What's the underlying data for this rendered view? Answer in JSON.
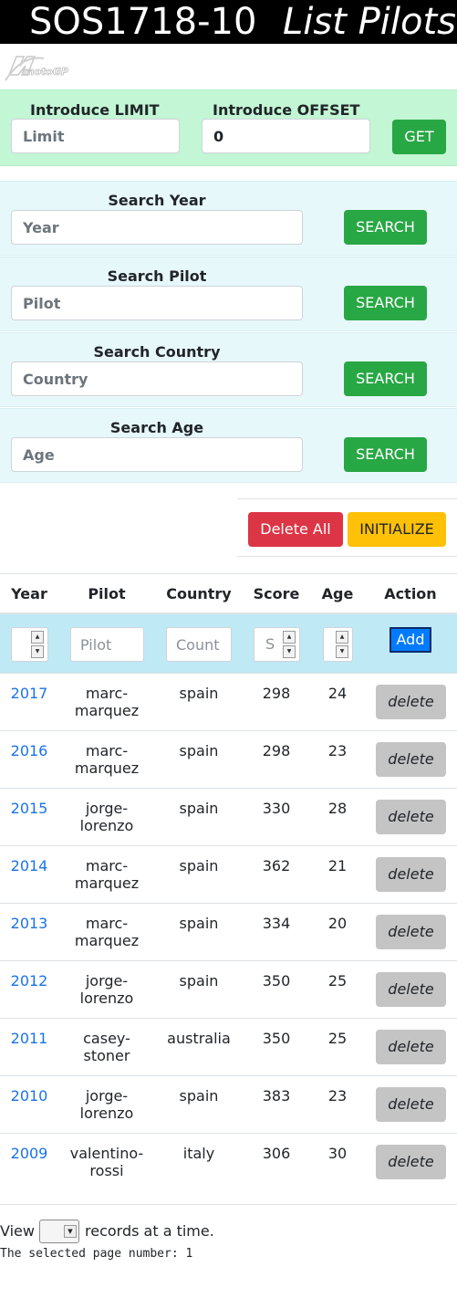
{
  "header": {
    "code": "SOS1718-10",
    "subtitle": "List Pilots"
  },
  "logo": {
    "text": "motoGP"
  },
  "limit_panel": {
    "limit_label": "Introduce LIMIT",
    "limit_placeholder": "Limit",
    "offset_label": "Introduce OFFSET",
    "offset_value": "0",
    "get_button": "GET"
  },
  "search": [
    {
      "label": "Search Year",
      "placeholder": "Year",
      "button": "SEARCH"
    },
    {
      "label": "Search Pilot",
      "placeholder": "Pilot",
      "button": "SEARCH"
    },
    {
      "label": "Search Country",
      "placeholder": "Country",
      "button": "SEARCH"
    },
    {
      "label": "Search Age",
      "placeholder": "Age",
      "button": "SEARCH"
    }
  ],
  "actions": {
    "delete_all": "Delete All",
    "initialize": "INITIALIZE"
  },
  "table": {
    "headers": [
      "Year",
      "Pilot",
      "Country",
      "Score",
      "Age",
      "Action"
    ],
    "new_row": {
      "pilot_placeholder": "Pilot",
      "country_placeholder": "Count",
      "score_placeholder": "S",
      "add_button": "Add"
    },
    "rows": [
      {
        "year": "2017",
        "pilot": "marc-marquez",
        "country": "spain",
        "score": "298",
        "age": "24",
        "action": "delete"
      },
      {
        "year": "2016",
        "pilot": "marc-marquez",
        "country": "spain",
        "score": "298",
        "age": "23",
        "action": "delete"
      },
      {
        "year": "2015",
        "pilot": "jorge-lorenzo",
        "country": "spain",
        "score": "330",
        "age": "28",
        "action": "delete"
      },
      {
        "year": "2014",
        "pilot": "marc-marquez",
        "country": "spain",
        "score": "362",
        "age": "21",
        "action": "delete"
      },
      {
        "year": "2013",
        "pilot": "marc-marquez",
        "country": "spain",
        "score": "334",
        "age": "20",
        "action": "delete"
      },
      {
        "year": "2012",
        "pilot": "jorge-lorenzo",
        "country": "spain",
        "score": "350",
        "age": "25",
        "action": "delete"
      },
      {
        "year": "2011",
        "pilot": "casey-stoner",
        "country": "australia",
        "score": "350",
        "age": "25",
        "action": "delete"
      },
      {
        "year": "2010",
        "pilot": "jorge-lorenzo",
        "country": "spain",
        "score": "383",
        "age": "23",
        "action": "delete"
      },
      {
        "year": "2009",
        "pilot": "valentino-rossi",
        "country": "italy",
        "score": "306",
        "age": "30",
        "action": "delete"
      }
    ]
  },
  "pager": {
    "view_prefix": "View",
    "view_suffix": "records at a time.",
    "selected_page_text": "The selected page number: 1"
  },
  "colors": {
    "limit_panel_bg": "#c3f6d4",
    "search_panel_bg": "#e7f8fb",
    "input_row_bg": "#bfe9f5",
    "success": "#28a745",
    "danger": "#dc3545",
    "warning": "#ffc107",
    "primary": "#007bff",
    "link": "#1a73e8"
  }
}
